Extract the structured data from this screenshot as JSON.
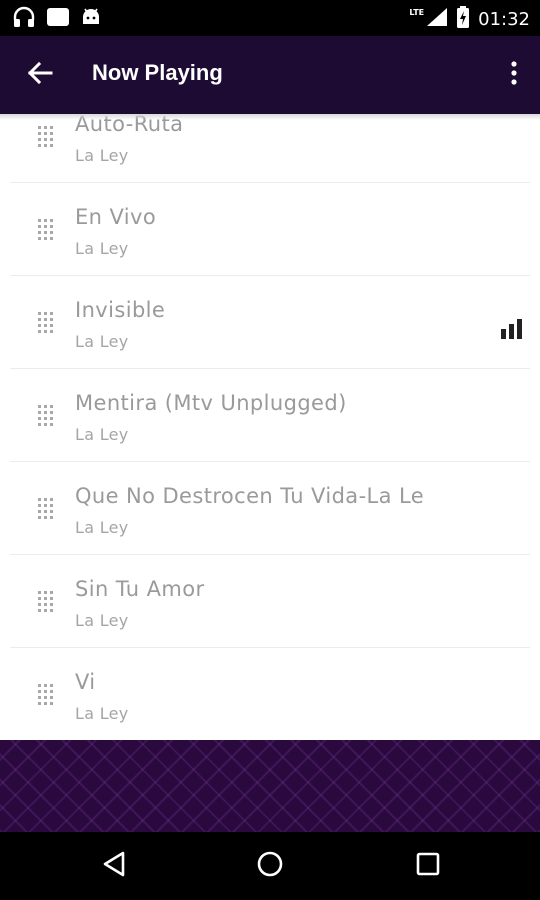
{
  "status_bar": {
    "network_label": "LTE",
    "time": "01:32"
  },
  "app_bar": {
    "title": "Now Playing"
  },
  "songs": [
    {
      "title": "Auto-Ruta",
      "artist": "La Ley",
      "playing": false
    },
    {
      "title": "En Vivo",
      "artist": "La Ley",
      "playing": false
    },
    {
      "title": "Invisible",
      "artist": "La Ley",
      "playing": true
    },
    {
      "title": "Mentira (Mtv Unplugged)",
      "artist": "La Ley",
      "playing": false
    },
    {
      "title": "Que No Destrocen Tu Vida-La Le",
      "artist": "La Ley",
      "playing": false
    },
    {
      "title": "Sin Tu Amor",
      "artist": "La Ley",
      "playing": false
    },
    {
      "title": "Vi",
      "artist": "La Ley",
      "playing": false
    }
  ],
  "colors": {
    "app_bar": "#1d0b33",
    "player_background": "#2a0a3e",
    "text_muted": "#9a9a9a"
  }
}
